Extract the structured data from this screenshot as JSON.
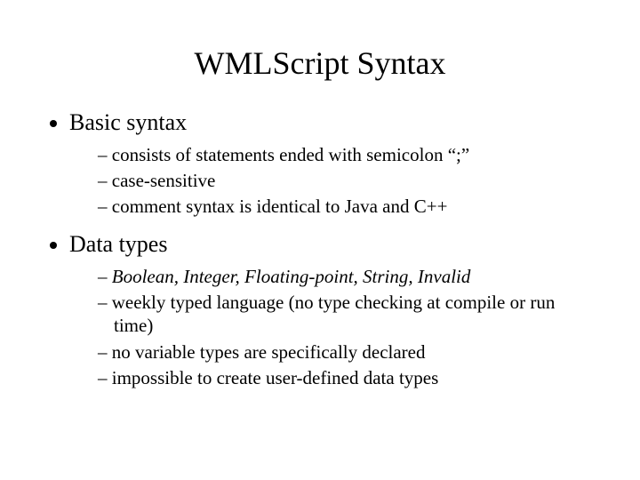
{
  "title": "WMLScript Syntax",
  "sections": [
    {
      "heading": "Basic syntax",
      "items": [
        {
          "text": "consists of statements ended with semicolon “;”",
          "italic": false
        },
        {
          "text": "case-sensitive",
          "italic": false
        },
        {
          "text": "comment syntax is identical to Java and C++",
          "italic": false
        }
      ]
    },
    {
      "heading": "Data types",
      "items": [
        {
          "text": "Boolean, Integer, Floating-point, String, Invalid",
          "italic": true
        },
        {
          "text": "weekly typed language (no type checking at compile or run time)",
          "italic": false
        },
        {
          "text": "no variable types are specifically declared",
          "italic": false
        },
        {
          "text": "impossible to create user-defined data types",
          "italic": false
        }
      ]
    }
  ]
}
